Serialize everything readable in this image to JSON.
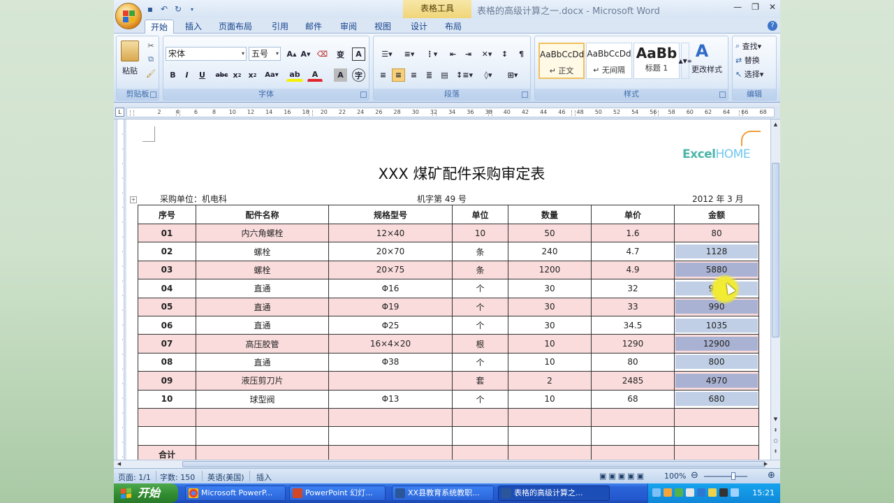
{
  "window": {
    "title": "表格的高级计算之一.docx - Microsoft Word",
    "context_tab": "表格工具",
    "controls": [
      "minimize",
      "maximize",
      "close"
    ]
  },
  "tabs": [
    "开始",
    "插入",
    "页面布局",
    "引用",
    "邮件",
    "审阅",
    "视图",
    "设计",
    "布局"
  ],
  "active_tab": "开始",
  "ribbon": {
    "clipboard": {
      "label": "剪贴板",
      "paste": "粘贴"
    },
    "font": {
      "label": "字体",
      "font_name": "宋体",
      "font_size": "五号"
    },
    "paragraph": {
      "label": "段落"
    },
    "styles": {
      "label": "样式",
      "items": [
        {
          "sample": "AaBbCcDd",
          "name": "↵ 正文"
        },
        {
          "sample": "AaBbCcDd",
          "name": "↵ 无间隔"
        },
        {
          "sample": "AaBb",
          "name": "标题 1"
        }
      ],
      "change": "更改样式"
    },
    "editing": {
      "label": "编辑",
      "find": "查找",
      "replace": "替换",
      "select": "选择"
    }
  },
  "ruler_ticks": [
    "2",
    "4",
    "6",
    "8",
    "10",
    "12",
    "14",
    "16",
    "18",
    "20",
    "22",
    "24",
    "26",
    "28",
    "30",
    "32",
    "34",
    "36",
    "38",
    "40",
    "42",
    "44",
    "46",
    "48",
    "50",
    "52",
    "54",
    "56",
    "58",
    "60",
    "62",
    "64",
    "66",
    "68"
  ],
  "document": {
    "brand": {
      "excel": "Excel",
      "home": "HOME"
    },
    "heading": "XXX 煤矿配件采购审定表",
    "purchase_unit": "采购单位：机电科",
    "doc_number": "机字第 49 号",
    "date": "2012 年 3 月",
    "table": {
      "headers": [
        "序号",
        "配件名称",
        "规格型号",
        "单位",
        "数量",
        "单价",
        "金额"
      ],
      "rows": [
        [
          "01",
          "内六角螺栓",
          "12×40",
          "10",
          "50",
          "1.6",
          "80"
        ],
        [
          "02",
          "螺栓",
          "20×70",
          "条",
          "240",
          "4.7",
          "1128"
        ],
        [
          "03",
          "螺栓",
          "20×75",
          "条",
          "1200",
          "4.9",
          "5880"
        ],
        [
          "04",
          "直通",
          "Φ16",
          "个",
          "30",
          "32",
          "960"
        ],
        [
          "05",
          "直通",
          "Φ19",
          "个",
          "30",
          "33",
          "990"
        ],
        [
          "06",
          "直通",
          "Φ25",
          "个",
          "30",
          "34.5",
          "1035"
        ],
        [
          "07",
          "高压胶管",
          "16×4×20",
          "根",
          "10",
          "1290",
          "12900"
        ],
        [
          "08",
          "直通",
          "Φ38",
          "个",
          "10",
          "80",
          "800"
        ],
        [
          "09",
          "液压剪刀片",
          "",
          "套",
          "2",
          "2485",
          "4970"
        ],
        [
          "10",
          "球型阀",
          "Φ13",
          "个",
          "10",
          "68",
          "680"
        ],
        [
          "",
          "",
          "",
          "",
          "",
          "",
          ""
        ],
        [
          "",
          "",
          "",
          "",
          "",
          "",
          ""
        ],
        [
          "合计",
          "",
          "",
          "",
          "",
          "",
          ""
        ]
      ]
    }
  },
  "status": {
    "page": "页面: 1/1",
    "words": "字数: 150",
    "language": "英语(美国)",
    "mode": "插入",
    "zoom": "100%"
  },
  "taskbar": {
    "start": "开始",
    "tasks": [
      "Microsoft PowerP...",
      "PowerPoint 幻灯...",
      "XX县教育系统教职...",
      "表格的高级计算之..."
    ],
    "clock": "15:21"
  },
  "colors": {
    "pink_row": "#fadcdc",
    "selection": "#c0cfe6",
    "highlight": "#f4ef2c",
    "taskbar": "#2458cf"
  }
}
